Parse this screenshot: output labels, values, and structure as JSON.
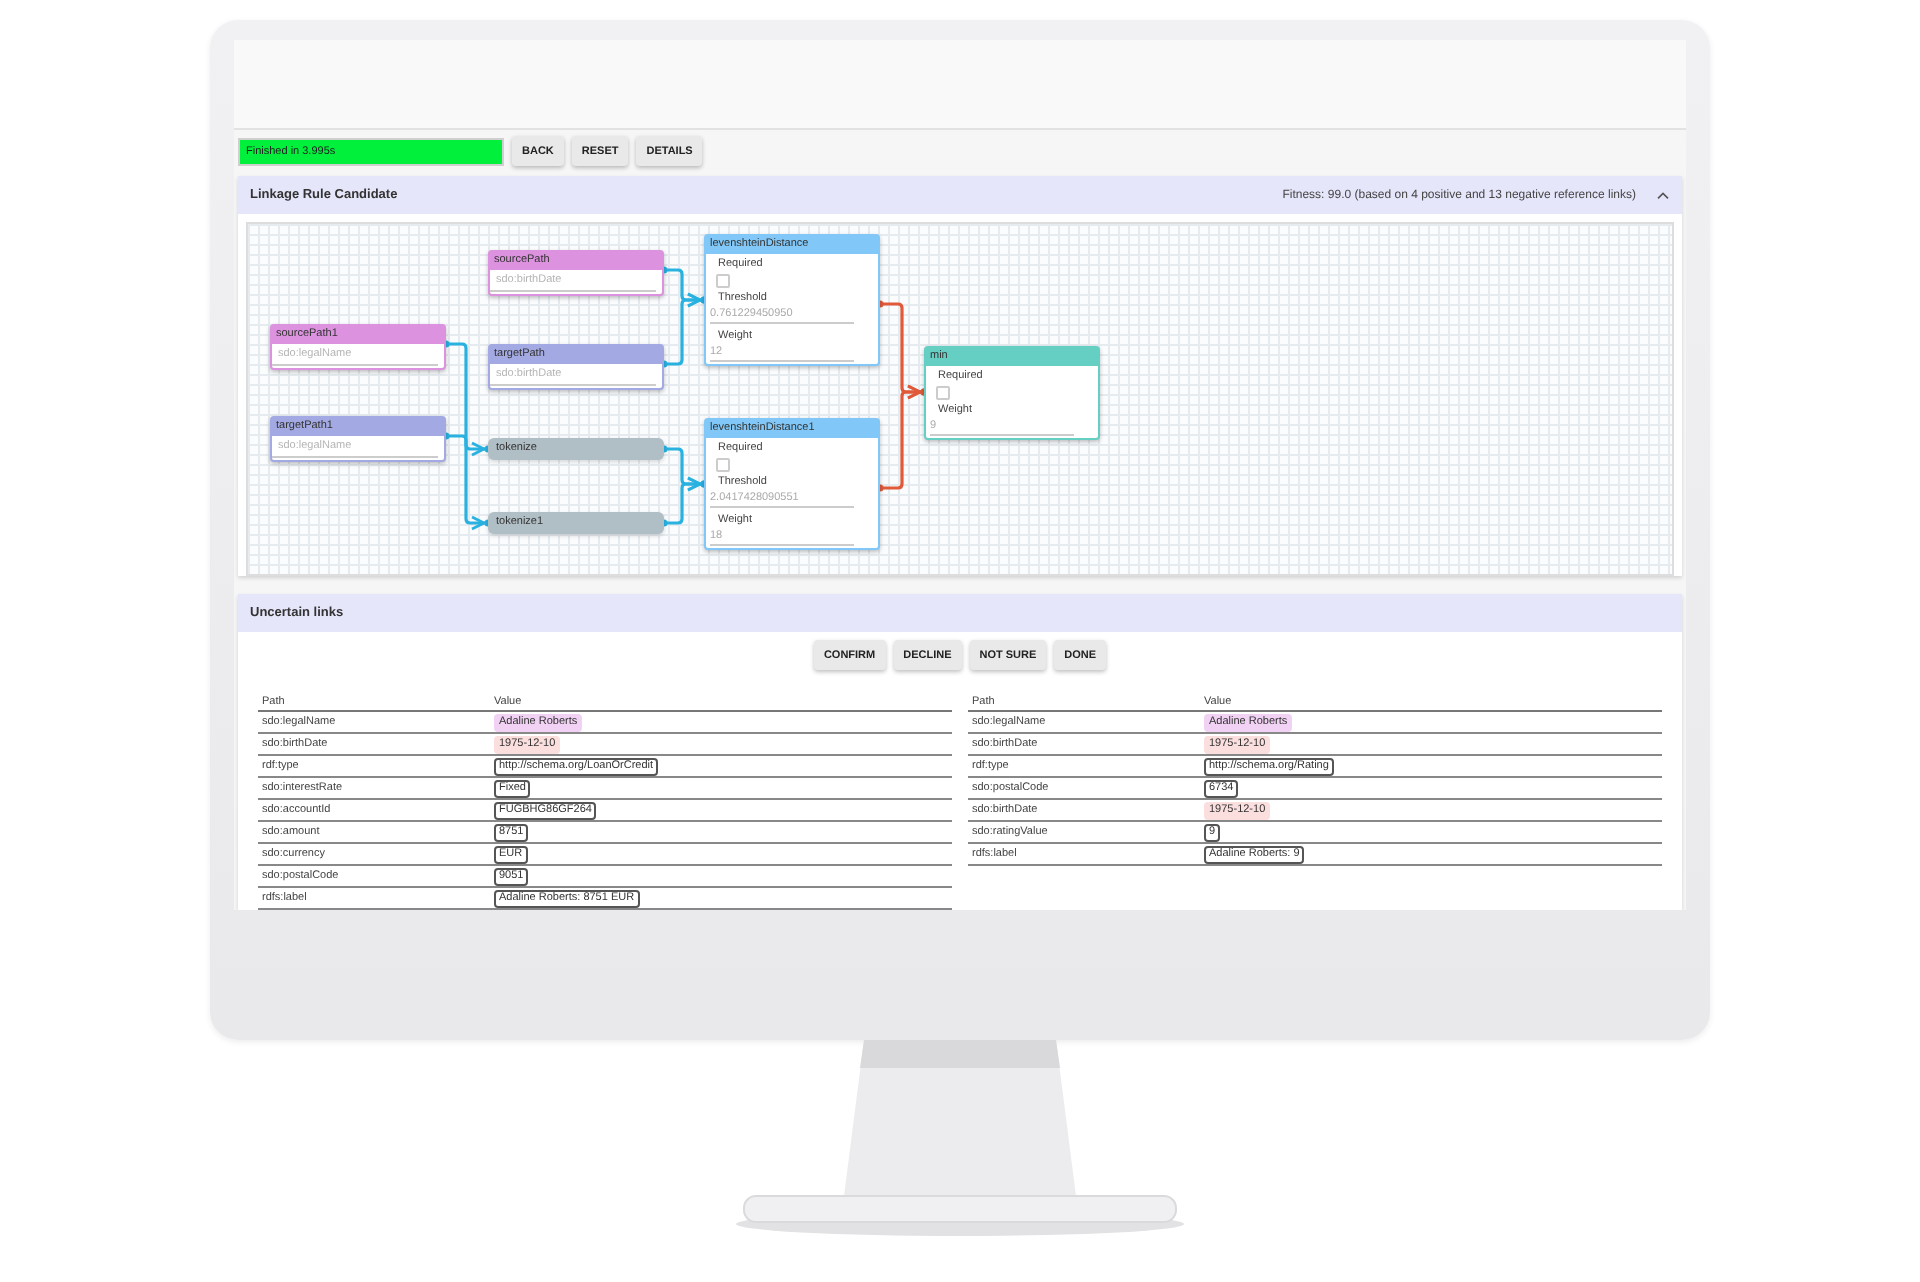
{
  "toolbar": {
    "status": "Finished in 3.995s",
    "buttons": [
      "BACK",
      "RESET",
      "DETAILS"
    ]
  },
  "linkage_panel": {
    "title": "Linkage Rule Candidate",
    "fitness": "Fitness: 99.0 (based on 4 positive and 13 negative reference links)",
    "expanded": true,
    "graph": {
      "kind": "aggregation",
      "title": "min",
      "color": "#66cfc4",
      "fields": [
        {
          "kind": "checkbox",
          "label": "Required",
          "checked": false
        },
        {
          "kind": "text",
          "label": "Weight",
          "value": "9"
        }
      ],
      "children": [
        {
          "kind": "comparison",
          "title": "levenshteinDistance",
          "color": "#81c8f8",
          "fields": [
            {
              "kind": "checkbox",
              "label": "Required",
              "checked": false
            },
            {
              "kind": "text",
              "label": "Threshold",
              "value": "0.761229450950"
            },
            {
              "kind": "text",
              "label": "Weight",
              "value": "12"
            }
          ],
          "children": [
            {
              "kind": "path",
              "title": "sourcePath",
              "color": "#dc92df",
              "value": "sdo:birthDate"
            },
            {
              "kind": "path",
              "title": "targetPath",
              "color": "#a3a9e2",
              "value": "sdo:birthDate"
            }
          ]
        },
        {
          "kind": "comparison",
          "title": "levenshteinDistance1",
          "color": "#81c8f8",
          "fields": [
            {
              "kind": "checkbox",
              "label": "Required",
              "checked": false
            },
            {
              "kind": "text",
              "label": "Threshold",
              "value": "2.0417428090551"
            },
            {
              "kind": "text",
              "label": "Weight",
              "value": "18"
            }
          ],
          "children": [
            {
              "kind": "transform",
              "title": "tokenize",
              "color": "#b0bec5",
              "children": [
                {
                  "kind": "path",
                  "title": "sourcePath1",
                  "color": "#dc92df",
                  "value": "sdo:legalName"
                }
              ]
            },
            {
              "kind": "transform",
              "title": "tokenize1",
              "color": "#b0bec5",
              "children": [
                {
                  "kind": "path",
                  "title": "targetPath1",
                  "color": "#a3a9e2",
                  "value": "sdo:legalName"
                }
              ]
            }
          ]
        }
      ]
    }
  },
  "uncertain_links": {
    "title": "Uncertain links",
    "buttons": [
      "CONFIRM",
      "DECLINE",
      "NOT SURE",
      "DONE"
    ],
    "tables": [
      {
        "columns": [
          "Path",
          "Value"
        ],
        "rows": [
          {
            "path": "sdo:legalName",
            "value": "Adaline Roberts",
            "color": "#f1d2f4"
          },
          {
            "path": "sdo:birthDate",
            "value": "1975-12-10",
            "color": "#fbdede"
          },
          {
            "path": "rdf:type",
            "value": "http://schema.org/LoanOrCredit"
          },
          {
            "path": "sdo:interestRate",
            "value": "Fixed"
          },
          {
            "path": "sdo:accountId",
            "value": "FUGBHG86GF264"
          },
          {
            "path": "sdo:amount",
            "value": "8751"
          },
          {
            "path": "sdo:currency",
            "value": "EUR"
          },
          {
            "path": "sdo:postalCode",
            "value": "9051"
          },
          {
            "path": "rdfs:label",
            "value": "Adaline Roberts: 8751 EUR"
          }
        ]
      },
      {
        "columns": [
          "Path",
          "Value"
        ],
        "rows": [
          {
            "path": "sdo:legalName",
            "value": "Adaline Roberts",
            "color": "#f1d2f4"
          },
          {
            "path": "sdo:birthDate",
            "value": "1975-12-10",
            "color": "#fbdede"
          },
          {
            "path": "rdf:type",
            "value": "http://schema.org/Rating"
          },
          {
            "path": "sdo:postalCode",
            "value": "6734"
          },
          {
            "path": "sdo:birthDate",
            "value": "1975-12-10",
            "color": "#fbdede"
          },
          {
            "path": "sdo:ratingValue",
            "value": "9"
          },
          {
            "path": "rdfs:label",
            "value": "Adaline Roberts: 9"
          }
        ]
      }
    ]
  }
}
